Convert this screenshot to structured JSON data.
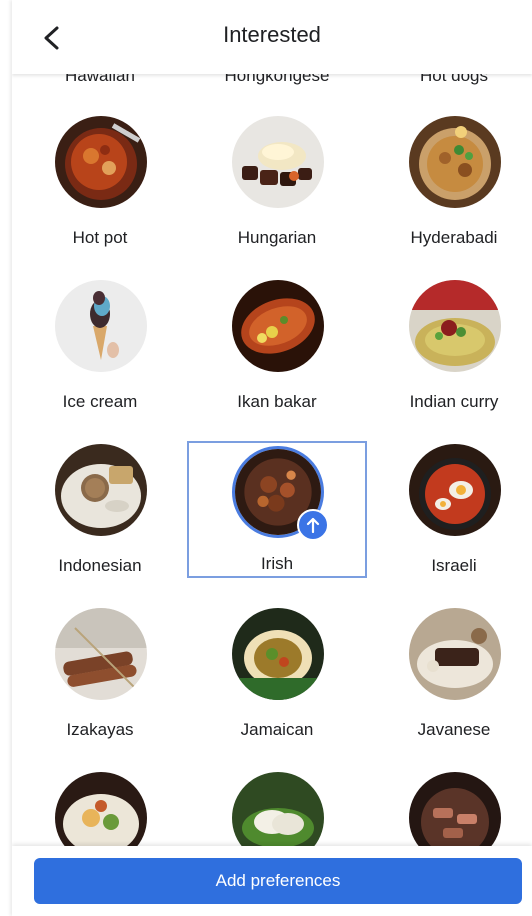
{
  "header": {
    "title": "Interested",
    "back_icon": "chevron-left-icon"
  },
  "partial_row": [
    "Hawaiian",
    "Hongkongese",
    "Hot dogs"
  ],
  "cuisines": [
    {
      "label": "Hot pot",
      "photo": "hot-pot-photo",
      "selected": false
    },
    {
      "label": "Hungarian",
      "photo": "hungarian-photo",
      "selected": false
    },
    {
      "label": "Hyderabadi",
      "photo": "hyderabadi-photo",
      "selected": false
    },
    {
      "label": "Ice cream",
      "photo": "ice-cream-photo",
      "selected": false
    },
    {
      "label": "Ikan bakar",
      "photo": "ikan-bakar-photo",
      "selected": false
    },
    {
      "label": "Indian curry",
      "photo": "indian-curry-photo",
      "selected": false
    },
    {
      "label": "Indonesian",
      "photo": "indonesian-photo",
      "selected": false
    },
    {
      "label": "Irish",
      "photo": "irish-photo",
      "selected": true,
      "badge_icon": "arrow-up-icon"
    },
    {
      "label": "Israeli",
      "photo": "israeli-photo",
      "selected": false
    },
    {
      "label": "Izakayas",
      "photo": "izakayas-photo",
      "selected": false
    },
    {
      "label": "Jamaican",
      "photo": "jamaican-photo",
      "selected": false
    },
    {
      "label": "Javanese",
      "photo": "javanese-photo",
      "selected": false
    }
  ],
  "footer": {
    "button_label": "Add preferences"
  },
  "colors": {
    "accent": "#2f6fde",
    "selection_border": "#7b9ee0",
    "badge": "#3b74e6"
  }
}
